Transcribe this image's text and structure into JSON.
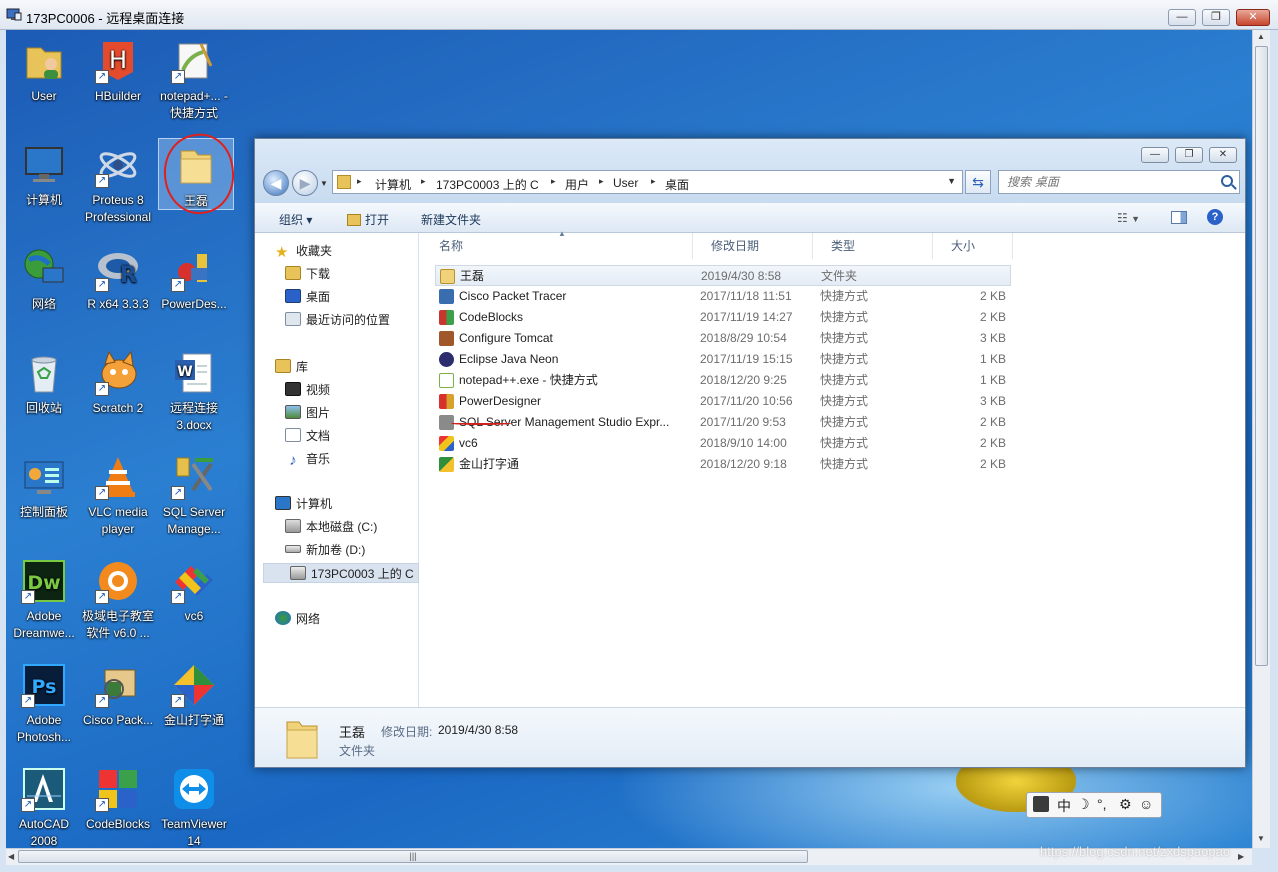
{
  "rdp": {
    "title": "173PC0006 - 远程桌面连接",
    "min_btn": "—",
    "max_btn": "❐",
    "close_btn": "✕"
  },
  "desktop": {
    "icons": [
      {
        "label": "User",
        "icon": "user-folder-icon"
      },
      {
        "label": "HBuilder",
        "icon": "hbuilder-icon"
      },
      {
        "label": "notepad+... - 快捷方式",
        "icon": "notepad-plus-icon"
      },
      {
        "label": "计算机",
        "icon": "computer-icon"
      },
      {
        "label": "Proteus 8 Professional",
        "icon": "proteus-icon"
      },
      {
        "label": "王磊",
        "icon": "folder-icon"
      },
      {
        "label": "网络",
        "icon": "network-icon"
      },
      {
        "label": "R x64 3.3.3",
        "icon": "r-icon"
      },
      {
        "label": "PowerDes...",
        "icon": "powerdesigner-icon"
      },
      {
        "label": "回收站",
        "icon": "recycle-bin-icon"
      },
      {
        "label": "Scratch 2",
        "icon": "scratch-icon"
      },
      {
        "label": "远程连接 3.docx",
        "icon": "word-doc-icon"
      },
      {
        "label": "控制面板",
        "icon": "control-panel-icon"
      },
      {
        "label": "VLC media player",
        "icon": "vlc-icon"
      },
      {
        "label": "SQL Server Manage...",
        "icon": "sql-server-icon"
      },
      {
        "label": "Adobe Dreamwe...",
        "icon": "dreamweaver-icon"
      },
      {
        "label": "极域电子教室 软件 v6.0 ...",
        "icon": "classroom-icon"
      },
      {
        "label": "vc6",
        "icon": "vc6-icon"
      },
      {
        "label": "Adobe Photosh...",
        "icon": "photoshop-icon"
      },
      {
        "label": "Cisco Pack...",
        "icon": "cisco-icon"
      },
      {
        "label": "金山打字通",
        "icon": "typing-icon"
      },
      {
        "label": "AutoCAD 2008",
        "icon": "autocad-icon"
      },
      {
        "label": "CodeBlocks",
        "icon": "codeblocks-icon"
      },
      {
        "label": "TeamViewer 14",
        "icon": "teamviewer-icon"
      }
    ]
  },
  "explorer": {
    "breadcrumb": [
      "计算机",
      "173PC0003 上的 C",
      "用户",
      "User",
      "桌面"
    ],
    "search_placeholder": "搜索 桌面",
    "toolbar": {
      "organize": "组织 ▾",
      "open": "打开",
      "new_folder": "新建文件夹"
    },
    "nav": {
      "favorites": "收藏夹",
      "fav_items": [
        "下载",
        "桌面",
        "最近访问的位置"
      ],
      "libraries": "库",
      "lib_items": [
        "视频",
        "图片",
        "文档",
        "音乐"
      ],
      "computer": "计算机",
      "comp_items": [
        "本地磁盘 (C:)",
        "新加卷 (D:)",
        "173PC0003 上的 C"
      ],
      "network": "网络"
    },
    "columns": {
      "name": "名称",
      "date": "修改日期",
      "type": "类型",
      "size": "大小"
    },
    "files": [
      {
        "name": "王磊",
        "date": "2019/4/30 8:58",
        "type": "文件夹",
        "size": "",
        "color": "#e8c35a"
      },
      {
        "name": "Cisco Packet Tracer",
        "date": "2017/11/18 11:51",
        "type": "快捷方式",
        "size": "2 KB",
        "color": "#3a6db0"
      },
      {
        "name": "CodeBlocks",
        "date": "2017/11/19 14:27",
        "type": "快捷方式",
        "size": "2 KB",
        "color": "#c8372d"
      },
      {
        "name": "Configure Tomcat",
        "date": "2018/8/29 10:54",
        "type": "快捷方式",
        "size": "3 KB",
        "color": "#a0582a"
      },
      {
        "name": "Eclipse Java Neon",
        "date": "2017/11/19 15:15",
        "type": "快捷方式",
        "size": "1 KB",
        "color": "#2c2c6e"
      },
      {
        "name": "notepad++.exe - 快捷方式",
        "date": "2018/12/20 9:25",
        "type": "快捷方式",
        "size": "1 KB",
        "color": "#7bb04a"
      },
      {
        "name": "PowerDesigner",
        "date": "2017/11/20 10:56",
        "type": "快捷方式",
        "size": "3 KB",
        "color": "#d8a12a"
      },
      {
        "name": "SQL Server Management Studio Expr...",
        "date": "2017/11/20 9:53",
        "type": "快捷方式",
        "size": "2 KB",
        "color": "#8a8a8a"
      },
      {
        "name": "vc6",
        "date": "2018/9/10 14:00",
        "type": "快捷方式",
        "size": "2 KB",
        "color": "#c73a3a"
      },
      {
        "name": "金山打字通",
        "date": "2018/12/20 9:18",
        "type": "快捷方式",
        "size": "2 KB",
        "color": "#2f8f3a"
      }
    ],
    "details": {
      "name": "王磊",
      "modified_label": "修改日期:",
      "modified_value": "2019/4/30 8:58",
      "type": "文件夹"
    }
  },
  "ime": {
    "lang": "中",
    "moon": "☽",
    "quote": "°,",
    "gear": "⚙",
    "smile": "☺"
  },
  "watermark": "https://blog.csdn.net/zxdspaopao"
}
